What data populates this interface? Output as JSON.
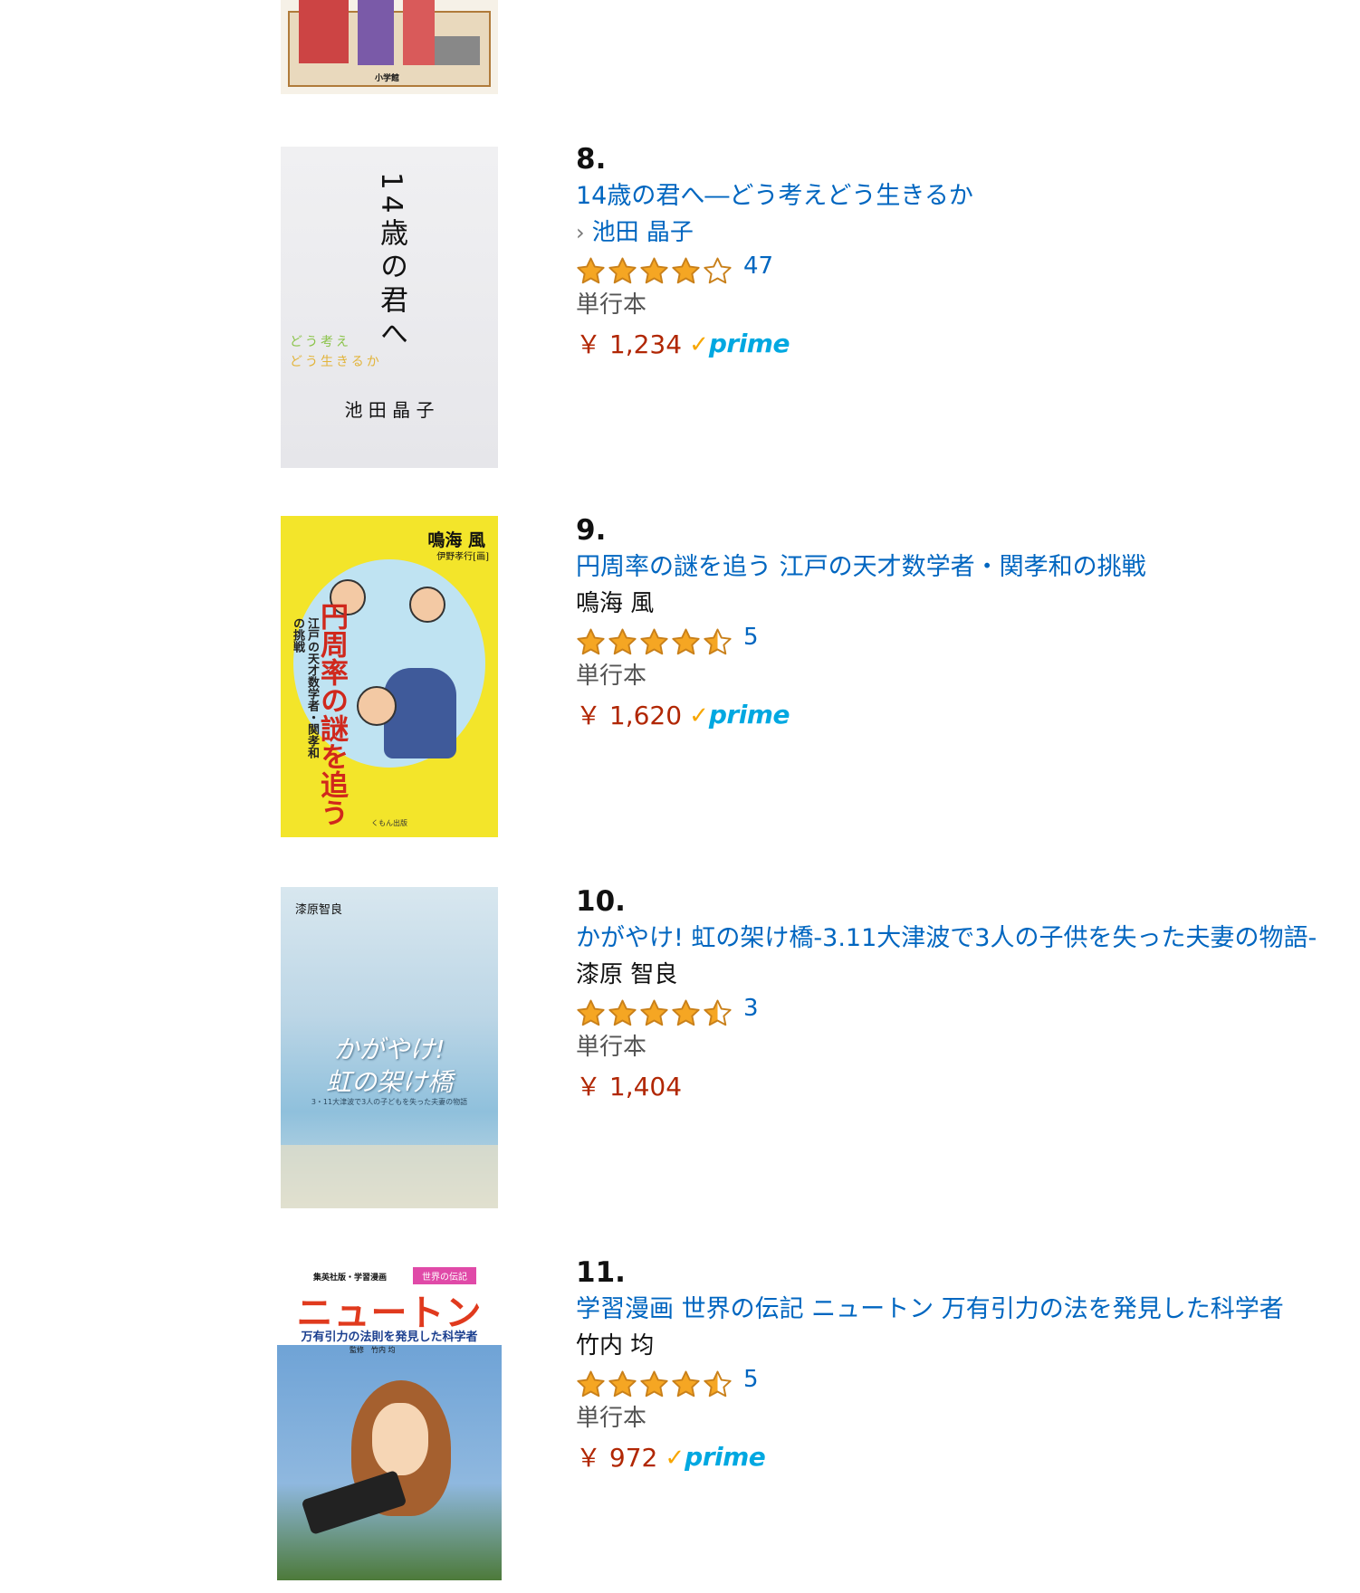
{
  "items": [
    {
      "rank": "8.",
      "title": "14歳の君へ―どう考えどう生きるか",
      "author": "池田 晶子",
      "author_linked": true,
      "rating": 4.0,
      "review_count": "47",
      "format": "単行本",
      "price": "￥ 1,234",
      "prime": true,
      "cover": {
        "title_vertical": "14歳の君へ",
        "subtitle_lines": [
          "どう考え",
          "どう生きるか"
        ],
        "author_text": "池 田 晶 子"
      }
    },
    {
      "rank": "9.",
      "title": "円周率の謎を追う 江戸の天才数学者・関孝和の挑戦",
      "author": "鳴海 風",
      "author_linked": false,
      "rating": 4.5,
      "review_count": "5",
      "format": "単行本",
      "price": "￥ 1,620",
      "prime": true,
      "cover": {
        "author_text": "鳴海 風",
        "illustrator_text": "伊野孝行[画]",
        "title_vertical": "円周率の謎を追う",
        "subtitle_vertical": "江戸の天才数学者・関孝和の挑戦",
        "publisher": "くもん出版"
      }
    },
    {
      "rank": "10.",
      "title": "かがやけ! 虹の架け橋-3.11大津波で3人の子供を失った夫妻の物語-",
      "author": "漆原 智良",
      "author_linked": false,
      "rating": 4.5,
      "review_count": "3",
      "format": "単行本",
      "price": "￥ 1,404",
      "prime": false,
      "cover": {
        "author_text": "漆原智良",
        "title_lines": [
          "かがやけ!",
          "虹の架け橋"
        ],
        "subtitle": "3・11大津波で3人の子どもを失った夫妻の物語"
      }
    },
    {
      "rank": "11.",
      "title": "学習漫画 世界の伝記 ニュートン 万有引力の法を発見した科学者",
      "author": "竹内 均",
      "author_linked": false,
      "rating": 4.5,
      "review_count": "5",
      "format": "単行本",
      "price": "￥ 972",
      "prime": true,
      "cover": {
        "series_text": "集英社版・学習漫画",
        "series_badge": "世界の伝記",
        "title": "ニュートン",
        "subtitle": "万有引力の法則を発見した科学者",
        "supervisor": "監修　竹内 均"
      }
    }
  ],
  "top_partial_cover": {
    "publisher": "小学館"
  },
  "colors": {
    "link": "#0066c0",
    "price": "#b12704",
    "star": "#f5a623",
    "prime_check": "#f7a600",
    "prime_text": "#00a8e1"
  },
  "labels": {
    "prime": "prime"
  }
}
